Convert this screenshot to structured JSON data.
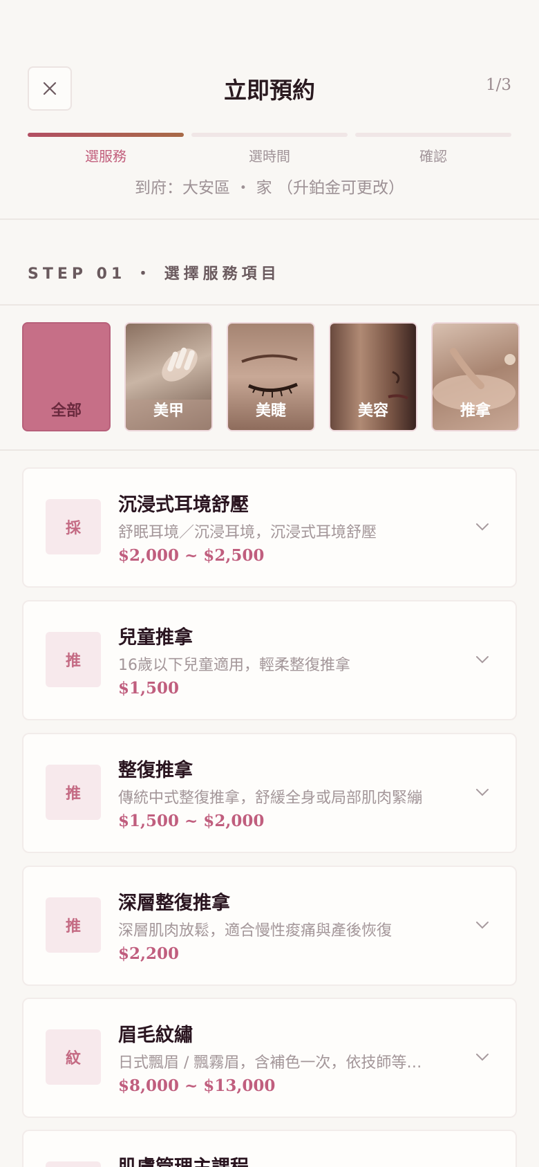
{
  "header": {
    "title": "立即預約",
    "step_count": "1/3",
    "steps": [
      "選服務",
      "選時間",
      "確認"
    ],
    "location": "到府：大安區 ・ 家 （升鉑金可更改）"
  },
  "section": {
    "title": "STEP 01 ・ 選擇服務項目"
  },
  "categories": [
    {
      "label": "全部",
      "selected": true
    },
    {
      "label": "美甲"
    },
    {
      "label": "美睫"
    },
    {
      "label": "美容"
    },
    {
      "label": "推拿"
    }
  ],
  "services": [
    {
      "badge": "採",
      "name": "沉浸式耳境舒壓",
      "desc": "舒眠耳境／沉浸耳境，沉浸式耳境舒壓",
      "price": "$2,000 ~ $2,500"
    },
    {
      "badge": "推",
      "name": "兒童推拿",
      "desc": "16歲以下兒童適用，輕柔整復推拿",
      "price": "$1,500"
    },
    {
      "badge": "推",
      "name": "整復推拿",
      "desc": "傳統中式整復推拿，舒緩全身或局部肌肉緊繃",
      "price": "$1,500 ~ $2,000"
    },
    {
      "badge": "推",
      "name": "深層整復推拿",
      "desc": "深層肌肉放鬆，適合慢性痠痛與產後恢復",
      "price": "$2,200"
    },
    {
      "badge": "紋",
      "name": "眉毛紋繡",
      "desc": "日式飄眉 / 飄霧眉，含補色一次，依技師等…",
      "price": "$8,000 ~ $13,000"
    },
    {
      "badge": "",
      "name": "肌膚管理主課程",
      "desc": "",
      "price": ""
    }
  ],
  "colors": {
    "accent": "#c05e7e",
    "selected_category": "#c66f87",
    "badge_bg": "#f7e9ec"
  }
}
